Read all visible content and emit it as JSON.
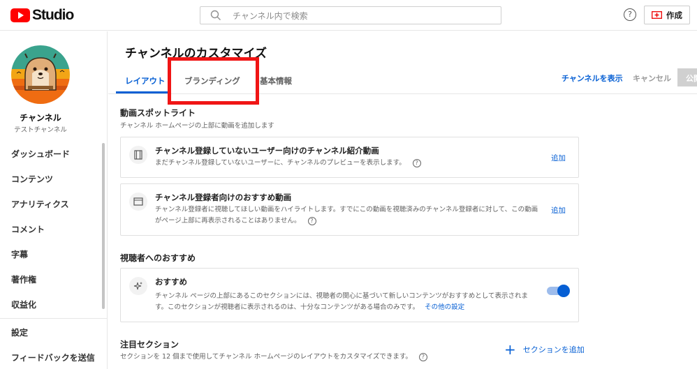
{
  "header": {
    "logo_text": "Studio",
    "search_placeholder": "チャンネル内で検索",
    "help": "?",
    "create_label": "作成"
  },
  "sidebar": {
    "channel_name": "チャンネル",
    "channel_sub": "テストチャンネル",
    "items": [
      {
        "label": "ダッシュボード"
      },
      {
        "label": "コンテンツ"
      },
      {
        "label": "アナリティクス"
      },
      {
        "label": "コメント"
      },
      {
        "label": "字幕"
      },
      {
        "label": "著作権"
      },
      {
        "label": "収益化"
      }
    ],
    "bottom_items": [
      {
        "label": "設定"
      },
      {
        "label": "フィードバックを送信"
      }
    ]
  },
  "main": {
    "title": "チャンネルのカスタマイズ",
    "tabs": [
      {
        "label": "レイアウト"
      },
      {
        "label": "ブランディング"
      },
      {
        "label": "基本情報"
      }
    ],
    "actions": {
      "view_channel": "チャンネルを表示",
      "cancel": "キャンセル",
      "publish": "公開"
    },
    "spotlight": {
      "title": "動画スポットライト",
      "desc": "チャンネル ホームページの上部に動画を追加します",
      "cards": [
        {
          "title": "チャンネル登録していないユーザー向けのチャンネル紹介動画",
          "desc": "まだチャンネル登録していないユーザーに、チャンネルのプレビューを表示します。",
          "add": "追加"
        },
        {
          "title": "チャンネル登録者向けのおすすめ動画",
          "desc1": "チャンネル登録者に視聴してほしい動画をハイライトします。すでにこの動画を視聴済みのチャンネル登録者に対して、この動画",
          "desc2": "がページ上部に再表示されることはありません。",
          "add": "追加"
        }
      ]
    },
    "recommend": {
      "title": "視聴者へのおすすめ",
      "card": {
        "title": "おすすめ",
        "desc1": "チャンネル ページの上部にあるこのセクションには、視聴者の関心に基づいて新しいコンテンツがおすすめとして表示されま",
        "desc2": "す。このセクションが視聴者に表示されるのは、十分なコンテンツがある場合のみです。",
        "more": "その他の設定",
        "enabled": true
      }
    },
    "featured": {
      "title": "注目セクション",
      "desc": "セクションを 12 個まで使用してチャンネル ホームページのレイアウトをカスタマイズできます。",
      "add_section": "セクションを追加"
    }
  }
}
